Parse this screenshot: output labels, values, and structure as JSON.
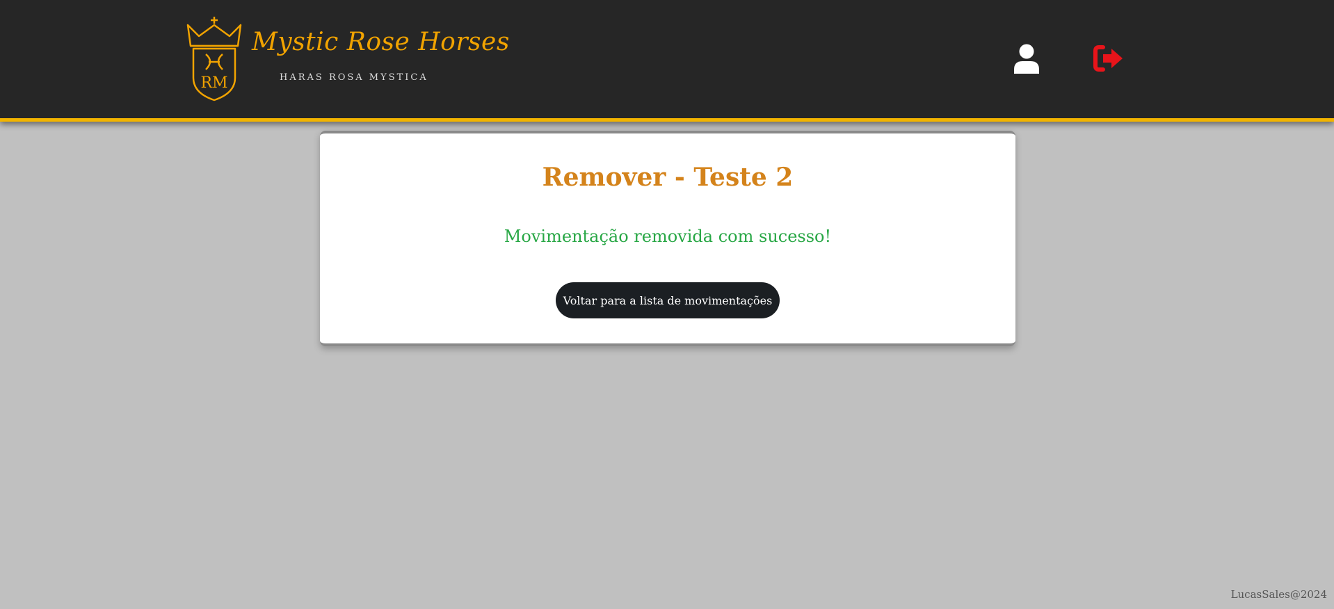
{
  "header": {
    "brand_name": "Mystic Rose Horses",
    "brand_subtitle": "HARAS ROSA MYSTICA",
    "logo_monogram": "RM",
    "accent_color": "#f2b400",
    "user_icon": "user-icon",
    "logout_icon": "sign-out-icon",
    "logout_color": "#e8141a"
  },
  "card": {
    "title": "Remover - Teste 2",
    "message": "Movimentação removida com sucesso!",
    "back_button_label": "Voltar para a lista de movimentações",
    "title_color": "#d4831b",
    "message_color": "#28a745"
  },
  "footer": {
    "credit": "LucasSales@2024"
  }
}
